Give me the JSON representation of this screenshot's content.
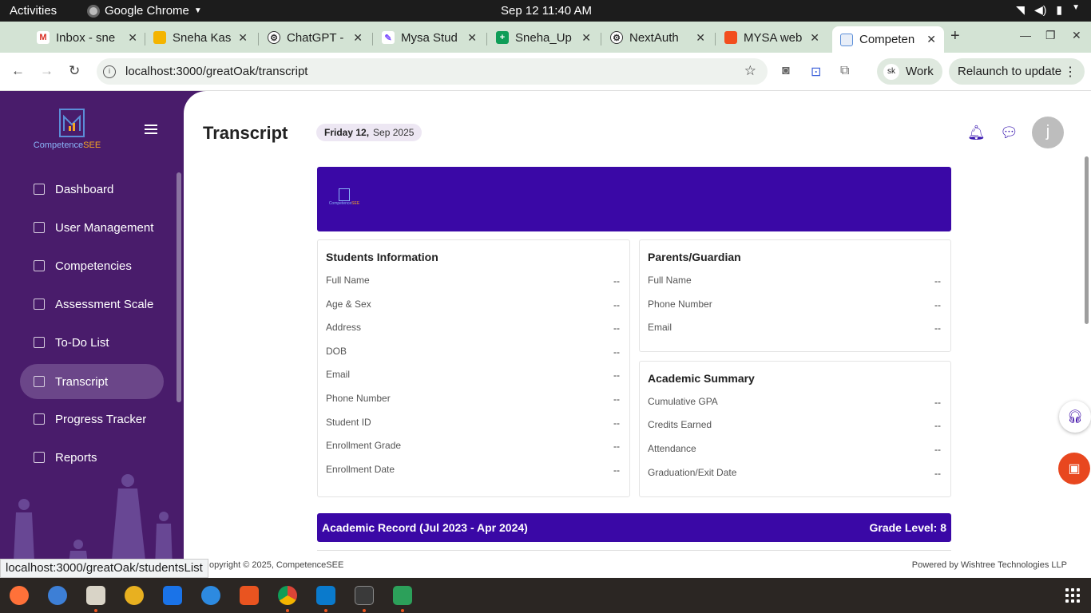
{
  "system": {
    "activities": "Activities",
    "app_name": "Google Chrome",
    "clock": "Sep 12  11:40 AM"
  },
  "tabs": [
    {
      "title": "Inbox - sne",
      "favicon": "gmail-icon",
      "color": "#d93025"
    },
    {
      "title": "Sneha Kas",
      "favicon": "slides-icon",
      "color": "#f4b400"
    },
    {
      "title": "ChatGPT -",
      "favicon": "chatgpt-icon",
      "color": "#333333"
    },
    {
      "title": "Mysa Stud",
      "favicon": "mysa-icon",
      "color": "#7c4dff"
    },
    {
      "title": "Sneha_Up",
      "favicon": "sheets-icon",
      "color": "#0f9d58"
    },
    {
      "title": "NextAuth",
      "favicon": "chatgpt-icon",
      "color": "#333333"
    },
    {
      "title": "MYSA web",
      "favicon": "figma-icon",
      "color": "#f24e1e"
    },
    {
      "title": "Competen",
      "favicon": "page-icon",
      "color": "#5b8ed8"
    }
  ],
  "address": {
    "url": "localhost:3000/greatOak/transcript",
    "profile_initials": "sk",
    "profile_label": "Work",
    "relaunch": "Relaunch to update"
  },
  "brand": {
    "name_part1": "Competence",
    "name_part2": "SEE"
  },
  "sidebar": {
    "items": [
      {
        "label": "Dashboard",
        "id": "dashboard"
      },
      {
        "label": "User Management",
        "id": "user-management"
      },
      {
        "label": "Competencies",
        "id": "competencies"
      },
      {
        "label": "Assessment Scale",
        "id": "assessment-scale"
      },
      {
        "label": "To-Do List",
        "id": "todo-list"
      },
      {
        "label": "Transcript",
        "id": "transcript"
      },
      {
        "label": "Progress Tracker",
        "id": "progress-tracker"
      },
      {
        "label": "Reports",
        "id": "reports"
      }
    ],
    "active": "Transcript"
  },
  "header": {
    "title": "Transcript",
    "date_day": "Friday 12,",
    "date_month": "Sep 2025",
    "avatar_letter": "j"
  },
  "students_info": {
    "heading": "Students Information",
    "rows": [
      {
        "label": "Full Name",
        "value": "--"
      },
      {
        "label": "Age & Sex",
        "value": "--"
      },
      {
        "label": "Address",
        "value": "--"
      },
      {
        "label": "DOB",
        "value": "--"
      },
      {
        "label": "Email",
        "value": "--"
      },
      {
        "label": "Phone Number",
        "value": "--"
      },
      {
        "label": "Student ID",
        "value": "--"
      },
      {
        "label": "Enrollment Grade",
        "value": "--"
      },
      {
        "label": "Enrollment Date",
        "value": "--"
      }
    ]
  },
  "guardian": {
    "heading": "Parents/Guardian",
    "rows": [
      {
        "label": "Full Name",
        "value": "--"
      },
      {
        "label": "Phone Number",
        "value": "--"
      },
      {
        "label": "Email",
        "value": "--"
      }
    ]
  },
  "academic_summary": {
    "heading": "Academic Summary",
    "rows": [
      {
        "label": "Cumulative GPA",
        "value": "--"
      },
      {
        "label": "Credits Earned",
        "value": "--"
      },
      {
        "label": "Attendance",
        "value": "--"
      },
      {
        "label": "Graduation/Exit Date",
        "value": "--"
      }
    ]
  },
  "academic_record": {
    "title": "Academic Record (Jul 2023 - Apr 2024)",
    "grade_level": "Grade Level: 8"
  },
  "footer": {
    "copyright": "opyright © 2025, CompetenceSEE",
    "powered_by": "Powered by Wishtree Technologies LLP"
  },
  "status_link": "localhost:3000/greatOak/studentsList",
  "colors": {
    "sidebar": "#491c6b",
    "accent": "#3a08a6",
    "active_item": "#6b4689"
  }
}
